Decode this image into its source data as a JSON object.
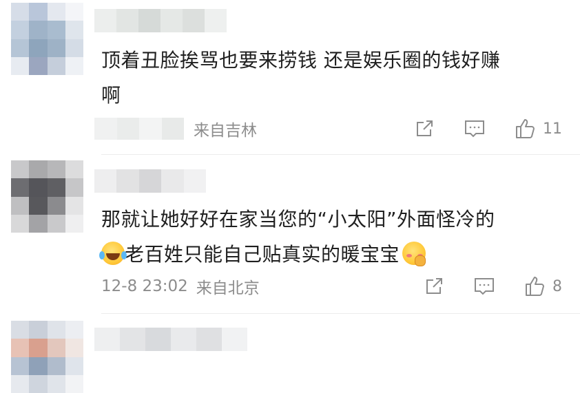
{
  "comments": [
    {
      "text_line1": "顶着丑脸挨骂也要来捞钱 还是娱乐圈的钱好赚",
      "text_line2": "啊",
      "location": "来自吉林",
      "like_count": "11"
    },
    {
      "text_line1": "那就让她好好在家当您的“小太阳”外面怪冷的",
      "text_line2": "老百姓只能自己贴真实的暖宝宝",
      "timestamp": "12-8 23:02",
      "location": "来自北京",
      "like_count": "8"
    }
  ],
  "icons": [
    "share-icon",
    "comment-icon",
    "like-icon",
    "laugh-tears-emoji",
    "shy-emoji"
  ],
  "colors": {
    "text": "#1f1f1f",
    "meta": "#8c8c8c",
    "divider": "#ececec",
    "icon": "#8c8c8c"
  }
}
